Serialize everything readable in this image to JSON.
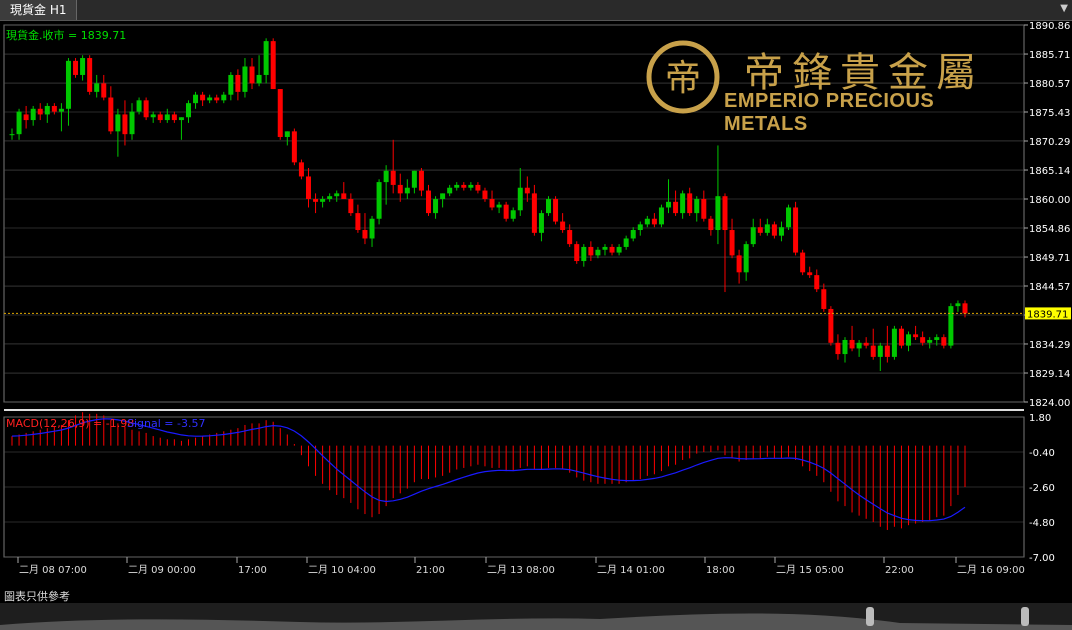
{
  "tab": {
    "title": "現貨金 H1"
  },
  "logo": {
    "chinese": "帝鋒貴金屬",
    "english": "EMPERIO PRECIOUS METALS",
    "emblem": "帝"
  },
  "main_panel": {
    "label": "現貨金.收市 = 1839.71",
    "price_axis": [
      "1890.86",
      "1885.71",
      "1880.57",
      "1875.43",
      "1870.29",
      "1865.14",
      "1860.00",
      "1854.86",
      "1849.71",
      "1844.57",
      "1839.43",
      "1834.29",
      "1829.14",
      "1824.00"
    ],
    "current_price": "1839.71"
  },
  "macd_panel": {
    "label_macd": "MACD(12,26,9) = -1.98",
    "label_signal": "Signal = -3.57",
    "axis": [
      "1.80",
      "-0.40",
      "-2.60",
      "-4.80",
      "-7.00"
    ]
  },
  "time_axis": [
    "二月 08 07:00",
    "二月 09 00:00",
    "17:00",
    "二月 10 04:00",
    "21:00",
    "二月 13 08:00",
    "二月 14 01:00",
    "18:00",
    "二月 15 05:00",
    "22:00",
    "二月 16 09:00"
  ],
  "footer": {
    "note": "圖表只供參考"
  },
  "colors": {
    "up": "#00c800",
    "down": "#ff0000",
    "signal": "#1a1aff",
    "grid": "#555555",
    "axis_text": "#ffffff",
    "price_label_bg": "#ffff00"
  },
  "chart_data": {
    "type": "candlestick",
    "title": "現貨金 H1",
    "price_ylim": [
      1824.0,
      1890.86
    ],
    "macd_ylim": [
      -7.0,
      1.8
    ],
    "ohlc": [
      [
        1871.5,
        1872.5,
        1870.5,
        1871.5
      ],
      [
        1871.5,
        1876.0,
        1870.5,
        1875.5
      ],
      [
        1875.0,
        1876.5,
        1872.5,
        1874.0
      ],
      [
        1874.0,
        1876.5,
        1873.0,
        1876.0
      ],
      [
        1876.0,
        1877.0,
        1874.0,
        1875.0
      ],
      [
        1875.0,
        1877.0,
        1873.5,
        1876.5
      ],
      [
        1876.5,
        1877.0,
        1875.0,
        1875.5
      ],
      [
        1875.5,
        1877.0,
        1872.0,
        1876.0
      ],
      [
        1876.0,
        1885.0,
        1873.0,
        1884.5
      ],
      [
        1884.5,
        1885.0,
        1881.5,
        1882.0
      ],
      [
        1882.0,
        1885.5,
        1881.0,
        1885.0
      ],
      [
        1885.0,
        1885.5,
        1878.5,
        1879.0
      ],
      [
        1879.0,
        1882.0,
        1878.0,
        1880.5
      ],
      [
        1880.5,
        1882.0,
        1877.5,
        1878.0
      ],
      [
        1878.0,
        1880.0,
        1871.5,
        1872.0
      ],
      [
        1872.0,
        1876.0,
        1867.5,
        1875.0
      ],
      [
        1875.0,
        1877.5,
        1869.5,
        1871.5
      ],
      [
        1871.5,
        1877.0,
        1870.5,
        1875.5
      ],
      [
        1875.5,
        1878.0,
        1875.0,
        1877.5
      ],
      [
        1877.5,
        1878.0,
        1874.0,
        1874.5
      ],
      [
        1874.5,
        1875.5,
        1873.5,
        1875.0
      ],
      [
        1875.0,
        1875.5,
        1873.5,
        1874.0
      ],
      [
        1874.0,
        1876.0,
        1873.5,
        1875.0
      ],
      [
        1875.0,
        1875.5,
        1873.5,
        1874.0
      ],
      [
        1874.0,
        1874.5,
        1870.5,
        1874.5
      ],
      [
        1874.5,
        1877.5,
        1873.5,
        1877.0
      ],
      [
        1877.0,
        1879.0,
        1876.0,
        1878.5
      ],
      [
        1878.5,
        1879.0,
        1876.5,
        1877.5
      ],
      [
        1877.5,
        1878.5,
        1877.0,
        1878.0
      ],
      [
        1878.0,
        1878.5,
        1877.0,
        1877.5
      ],
      [
        1877.5,
        1879.0,
        1877.0,
        1878.5
      ],
      [
        1878.5,
        1882.5,
        1877.5,
        1882.0
      ],
      [
        1882.0,
        1883.0,
        1877.5,
        1879.0
      ],
      [
        1879.0,
        1885.0,
        1878.0,
        1883.5
      ],
      [
        1883.5,
        1885.0,
        1879.5,
        1880.5
      ],
      [
        1880.5,
        1885.5,
        1880.0,
        1882.0
      ],
      [
        1882.0,
        1888.5,
        1880.5,
        1888.0
      ],
      [
        1888.0,
        1888.5,
        1879.5,
        1879.5
      ],
      [
        1879.5,
        1879.5,
        1870.5,
        1871.0
      ],
      [
        1871.0,
        1872.0,
        1869.5,
        1872.0
      ],
      [
        1872.0,
        1872.5,
        1866.0,
        1866.5
      ],
      [
        1866.5,
        1867.0,
        1863.5,
        1864.0
      ],
      [
        1864.0,
        1865.5,
        1858.5,
        1860.0
      ],
      [
        1860.0,
        1861.0,
        1857.5,
        1859.5
      ],
      [
        1859.5,
        1860.5,
        1858.5,
        1860.0
      ],
      [
        1860.0,
        1861.0,
        1859.5,
        1860.5
      ],
      [
        1860.5,
        1861.5,
        1859.5,
        1861.0
      ],
      [
        1861.0,
        1863.0,
        1860.0,
        1860.0
      ],
      [
        1860.0,
        1861.0,
        1857.0,
        1857.5
      ],
      [
        1857.5,
        1859.0,
        1854.0,
        1854.5
      ],
      [
        1854.5,
        1857.5,
        1852.0,
        1853.0
      ],
      [
        1853.0,
        1857.0,
        1851.5,
        1856.5
      ],
      [
        1856.5,
        1863.5,
        1855.5,
        1863.0
      ],
      [
        1863.0,
        1866.0,
        1859.0,
        1865.0
      ],
      [
        1865.0,
        1870.5,
        1861.0,
        1862.5
      ],
      [
        1862.5,
        1864.5,
        1859.5,
        1861.0
      ],
      [
        1861.0,
        1863.5,
        1860.0,
        1862.0
      ],
      [
        1862.0,
        1865.0,
        1861.0,
        1865.0
      ],
      [
        1865.0,
        1865.5,
        1860.5,
        1861.5
      ],
      [
        1861.5,
        1862.5,
        1857.0,
        1857.5
      ],
      [
        1857.5,
        1860.5,
        1856.5,
        1860.0
      ],
      [
        1860.0,
        1861.0,
        1858.5,
        1861.0
      ],
      [
        1861.0,
        1862.5,
        1860.5,
        1862.0
      ],
      [
        1862.0,
        1863.0,
        1861.5,
        1862.5
      ],
      [
        1862.5,
        1863.0,
        1861.5,
        1862.0
      ],
      [
        1862.0,
        1863.0,
        1861.5,
        1862.5
      ],
      [
        1862.5,
        1863.0,
        1861.0,
        1861.5
      ],
      [
        1861.5,
        1862.0,
        1859.5,
        1860.0
      ],
      [
        1860.0,
        1861.5,
        1858.0,
        1858.5
      ],
      [
        1858.5,
        1859.5,
        1857.5,
        1859.0
      ],
      [
        1859.0,
        1859.5,
        1856.0,
        1856.5
      ],
      [
        1856.5,
        1858.5,
        1856.0,
        1858.0
      ],
      [
        1858.0,
        1865.5,
        1857.0,
        1862.0
      ],
      [
        1862.0,
        1864.0,
        1859.5,
        1861.0
      ],
      [
        1861.0,
        1862.5,
        1853.5,
        1854.0
      ],
      [
        1854.0,
        1858.0,
        1852.5,
        1857.5
      ],
      [
        1857.5,
        1860.5,
        1857.0,
        1860.0
      ],
      [
        1860.0,
        1860.5,
        1855.5,
        1856.0
      ],
      [
        1856.0,
        1857.5,
        1854.0,
        1854.5
      ],
      [
        1854.5,
        1855.5,
        1851.5,
        1852.0
      ],
      [
        1852.0,
        1852.5,
        1848.5,
        1849.0
      ],
      [
        1849.0,
        1852.0,
        1848.0,
        1851.5
      ],
      [
        1851.5,
        1852.5,
        1849.0,
        1850.0
      ],
      [
        1850.0,
        1851.5,
        1849.5,
        1851.0
      ],
      [
        1851.0,
        1852.0,
        1850.0,
        1851.5
      ],
      [
        1851.5,
        1852.0,
        1850.0,
        1850.5
      ],
      [
        1850.5,
        1852.0,
        1850.0,
        1851.5
      ],
      [
        1851.5,
        1853.5,
        1851.0,
        1853.0
      ],
      [
        1853.0,
        1855.0,
        1852.5,
        1854.5
      ],
      [
        1854.5,
        1856.0,
        1853.5,
        1855.5
      ],
      [
        1855.5,
        1857.0,
        1855.0,
        1856.5
      ],
      [
        1856.5,
        1857.5,
        1855.0,
        1855.5
      ],
      [
        1855.5,
        1859.0,
        1855.0,
        1858.5
      ],
      [
        1858.5,
        1863.5,
        1857.5,
        1859.5
      ],
      [
        1859.5,
        1861.5,
        1857.0,
        1857.5
      ],
      [
        1857.5,
        1861.5,
        1856.5,
        1861.0
      ],
      [
        1861.0,
        1862.0,
        1857.0,
        1857.5
      ],
      [
        1857.5,
        1860.5,
        1856.0,
        1860.0
      ],
      [
        1860.0,
        1861.5,
        1856.0,
        1856.5
      ],
      [
        1856.5,
        1857.0,
        1853.5,
        1854.5
      ],
      [
        1854.5,
        1869.5,
        1852.0,
        1860.5
      ],
      [
        1860.5,
        1861.0,
        1843.5,
        1854.5
      ],
      [
        1854.5,
        1856.5,
        1849.5,
        1850.0
      ],
      [
        1850.0,
        1851.0,
        1845.0,
        1847.0
      ],
      [
        1847.0,
        1852.5,
        1845.5,
        1852.0
      ],
      [
        1852.0,
        1856.5,
        1851.5,
        1855.0
      ],
      [
        1855.0,
        1856.5,
        1853.5,
        1854.0
      ],
      [
        1854.0,
        1856.5,
        1853.5,
        1855.5
      ],
      [
        1855.5,
        1856.0,
        1853.0,
        1853.5
      ],
      [
        1853.5,
        1856.0,
        1852.5,
        1855.0
      ],
      [
        1855.0,
        1859.0,
        1854.5,
        1858.5
      ],
      [
        1858.5,
        1859.5,
        1850.0,
        1850.5
      ],
      [
        1850.5,
        1851.0,
        1846.5,
        1847.0
      ],
      [
        1847.0,
        1848.0,
        1846.0,
        1846.5
      ],
      [
        1846.5,
        1847.5,
        1843.5,
        1844.0
      ],
      [
        1844.0,
        1845.0,
        1840.0,
        1840.5
      ],
      [
        1840.5,
        1841.0,
        1834.0,
        1834.5
      ],
      [
        1834.5,
        1836.0,
        1831.5,
        1832.5
      ],
      [
        1832.5,
        1835.5,
        1831.0,
        1835.0
      ],
      [
        1835.0,
        1837.5,
        1833.0,
        1833.5
      ],
      [
        1833.5,
        1835.0,
        1832.0,
        1834.5
      ],
      [
        1834.5,
        1835.5,
        1833.5,
        1834.0
      ],
      [
        1834.0,
        1837.0,
        1831.5,
        1832.0
      ],
      [
        1832.0,
        1834.5,
        1829.5,
        1834.0
      ],
      [
        1834.0,
        1837.5,
        1831.0,
        1832.0
      ],
      [
        1832.0,
        1837.5,
        1831.5,
        1837.0
      ],
      [
        1837.0,
        1837.5,
        1833.5,
        1834.0
      ],
      [
        1834.0,
        1836.5,
        1833.0,
        1836.0
      ],
      [
        1836.0,
        1837.5,
        1835.0,
        1835.5
      ],
      [
        1835.5,
        1836.5,
        1834.0,
        1834.5
      ],
      [
        1834.5,
        1835.5,
        1833.5,
        1835.0
      ],
      [
        1835.0,
        1836.0,
        1834.0,
        1835.5
      ],
      [
        1835.5,
        1836.0,
        1833.5,
        1834.0
      ],
      [
        1834.0,
        1841.5,
        1833.5,
        1841.0
      ],
      [
        1841.0,
        1842.0,
        1840.0,
        1841.5
      ],
      [
        1841.5,
        1842.0,
        1839.0,
        1839.7
      ]
    ],
    "macd": [
      0.6,
      0.7,
      0.8,
      0.9,
      1.0,
      1.1,
      1.2,
      1.3,
      1.6,
      1.9,
      2.1,
      2.0,
      2.0,
      1.9,
      1.6,
      1.4,
      1.2,
      1.0,
      0.9,
      0.8,
      0.6,
      0.5,
      0.4,
      0.4,
      0.3,
      0.4,
      0.5,
      0.6,
      0.7,
      0.8,
      0.9,
      1.0,
      1.1,
      1.3,
      1.4,
      1.4,
      1.6,
      1.5,
      1.1,
      0.7,
      0.1,
      -0.6,
      -1.3,
      -1.9,
      -2.4,
      -2.8,
      -3.1,
      -3.3,
      -3.6,
      -4.0,
      -4.3,
      -4.5,
      -4.3,
      -3.8,
      -3.3,
      -3.0,
      -2.7,
      -2.3,
      -2.1,
      -2.1,
      -2.0,
      -1.9,
      -1.7,
      -1.5,
      -1.4,
      -1.3,
      -1.2,
      -1.3,
      -1.4,
      -1.4,
      -1.6,
      -1.6,
      -1.4,
      -1.3,
      -1.5,
      -1.5,
      -1.4,
      -1.4,
      -1.5,
      -1.7,
      -2.0,
      -2.2,
      -2.3,
      -2.4,
      -2.4,
      -2.4,
      -2.4,
      -2.3,
      -2.2,
      -2.1,
      -1.9,
      -1.8,
      -1.6,
      -1.3,
      -1.2,
      -0.9,
      -0.8,
      -0.5,
      -0.4,
      -0.4,
      -0.3,
      -0.6,
      -0.8,
      -1.0,
      -0.9,
      -0.8,
      -0.8,
      -0.7,
      -0.8,
      -0.8,
      -0.7,
      -0.9,
      -1.3,
      -1.6,
      -1.9,
      -2.3,
      -2.9,
      -3.5,
      -3.8,
      -4.2,
      -4.4,
      -4.6,
      -4.8,
      -5.1,
      -5.3,
      -5.1,
      -5.2,
      -5.0,
      -4.9,
      -4.8,
      -4.7,
      -4.5,
      -4.4,
      -3.8,
      -3.1,
      -2.6
    ]
  }
}
